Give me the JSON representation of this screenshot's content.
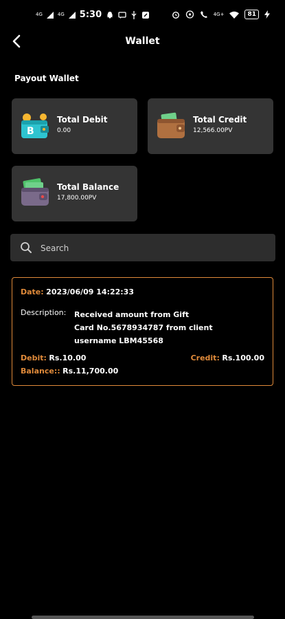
{
  "status_bar": {
    "net1": "4G",
    "net2": "4G",
    "time": "5:30",
    "battery": "81"
  },
  "header": {
    "title": "Wallet"
  },
  "section": {
    "title": "Payout Wallet"
  },
  "cards": {
    "debit": {
      "label": "Total Debit",
      "value": "0.00"
    },
    "credit": {
      "label": "Total Credit",
      "value": "12,566.00PV"
    },
    "balance": {
      "label": "Total Balance",
      "value": "17,800.00PV"
    }
  },
  "search": {
    "placeholder": "Search"
  },
  "transactions": [
    {
      "date_label": "Date:",
      "date": "2023/06/09 14:22:33",
      "description_label": "Description:",
      "description_lines": [
        "Received amount from Gift",
        "Card No.5678934787 from client",
        "username LBM45568"
      ],
      "debit_label": "Debit:",
      "debit": "Rs.10.00",
      "credit_label": "Credit:",
      "credit": "Rs.100.00",
      "balance_label": "Balance::",
      "balance": "Rs.11,700.00"
    }
  ],
  "colors": {
    "accent": "#e08a3a",
    "card_bg": "#343434",
    "background": "#000000"
  },
  "icons": [
    "back-arrow-icon",
    "bitcoin-wallet-icon",
    "leather-wallet-icon",
    "cash-wallet-icon",
    "search-icon"
  ]
}
